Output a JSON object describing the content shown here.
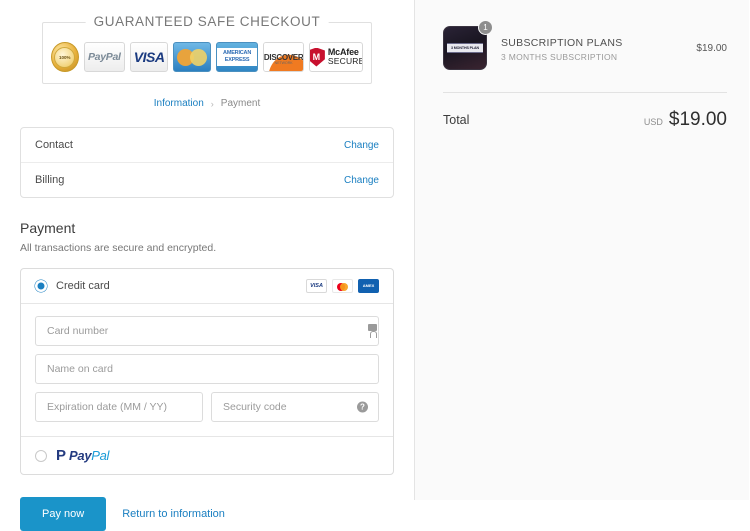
{
  "trust": {
    "title": "GUARANTEED SAFE CHECKOUT",
    "badges": [
      {
        "name": "guarantee-seal",
        "text": "100%"
      },
      {
        "name": "paypal",
        "text": "PayPal"
      },
      {
        "name": "visa",
        "text": "VISA"
      },
      {
        "name": "mastercard",
        "text": "MasterCard"
      },
      {
        "name": "american-express",
        "text": "AMERICAN EXPRESS"
      },
      {
        "name": "discover",
        "text": "DISCOVER",
        "sub": "NETWORK"
      },
      {
        "name": "mcafee-secure",
        "text": "McAfee",
        "sub": "SECURE",
        "mark": "M"
      }
    ]
  },
  "breadcrumb": {
    "information": "Information",
    "separator": "›",
    "payment": "Payment"
  },
  "review": {
    "rows": [
      {
        "label": "Contact",
        "action": "Change"
      },
      {
        "label": "Billing",
        "action": "Change"
      }
    ]
  },
  "payment": {
    "heading": "Payment",
    "subheading": "All transactions are secure and encrypted.",
    "credit_card": {
      "label": "Credit card",
      "selected": true,
      "accepted": [
        "VISA",
        "Mastercard",
        "AMEX"
      ]
    },
    "fields": {
      "card_number": {
        "placeholder": "Card number",
        "value": "",
        "icon": "lock-icon"
      },
      "name_on_card": {
        "placeholder": "Name on card",
        "value": ""
      },
      "expiration": {
        "placeholder": "Expiration date (MM / YY)",
        "value": ""
      },
      "security_code": {
        "placeholder": "Security code",
        "value": "",
        "icon": "help-icon"
      }
    },
    "paypal": {
      "label": "PayPal",
      "mark": "P",
      "word_a": "Pay",
      "word_b": "Pal",
      "selected": false
    }
  },
  "footer": {
    "pay_now": "Pay now",
    "return_link": "Return to information"
  },
  "summary": {
    "item": {
      "title": "SUBSCRIPTION PLANS",
      "subtitle": "3 MONTHS SUBSCRIPTION",
      "price": "$19.00",
      "quantity": "1",
      "thumbnail_text": "3 MONTHS PLAN"
    },
    "total": {
      "label": "Total",
      "currency": "USD",
      "amount": "$19.00"
    }
  },
  "colors": {
    "accent": "#1a94c9",
    "link": "#1a7fc1",
    "panel_bg": "#fafafa"
  }
}
